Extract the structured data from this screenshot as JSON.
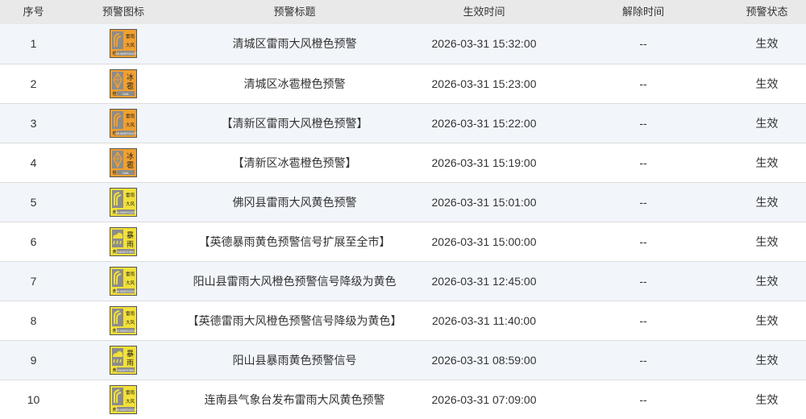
{
  "header": {
    "index": "序号",
    "icon": "预警图标",
    "title": "预警标题",
    "start_time": "生效时间",
    "end_time": "解除时间",
    "status": "预警状态"
  },
  "colors": {
    "orange": "#f0a030",
    "yellow": "#f2e13a",
    "grey": "#8c8c8c"
  },
  "rows": [
    {
      "index": "1",
      "icon": {
        "name": "thunder-wind-orange-icon",
        "type": "thunder-wind",
        "color": "orange",
        "top": "雷雨",
        "bottom": "大风",
        "tag": "橙",
        "foot": "THUNDERGUST"
      },
      "title": "清城区雷雨大风橙色预警",
      "start_time": "2026-03-31 15:32:00",
      "end_time": "--",
      "status": "生效"
    },
    {
      "index": "2",
      "icon": {
        "name": "hail-orange-icon",
        "type": "hail",
        "color": "orange",
        "top": "冰",
        "bottom": "雹",
        "tag": "橙",
        "foot": "HAIL"
      },
      "title": "清城区冰雹橙色预警",
      "start_time": "2026-03-31 15:23:00",
      "end_time": "--",
      "status": "生效"
    },
    {
      "index": "3",
      "icon": {
        "name": "thunder-wind-orange-icon",
        "type": "thunder-wind",
        "color": "orange",
        "top": "雷雨",
        "bottom": "大风",
        "tag": "橙",
        "foot": "THUNDERGUST"
      },
      "title": "【清新区雷雨大风橙色预警】",
      "start_time": "2026-03-31 15:22:00",
      "end_time": "--",
      "status": "生效"
    },
    {
      "index": "4",
      "icon": {
        "name": "hail-orange-icon",
        "type": "hail",
        "color": "orange",
        "top": "冰",
        "bottom": "雹",
        "tag": "橙",
        "foot": "HAIL"
      },
      "title": "【清新区冰雹橙色预警】",
      "start_time": "2026-03-31 15:19:00",
      "end_time": "--",
      "status": "生效"
    },
    {
      "index": "5",
      "icon": {
        "name": "thunder-wind-yellow-icon",
        "type": "thunder-wind",
        "color": "yellow",
        "top": "雷雨",
        "bottom": "大风",
        "tag": "黄",
        "foot": "THUNDERGUST"
      },
      "title": "佛冈县雷雨大风黄色预警",
      "start_time": "2026-03-31 15:01:00",
      "end_time": "--",
      "status": "生效"
    },
    {
      "index": "6",
      "icon": {
        "name": "rainstorm-yellow-icon",
        "type": "rainstorm",
        "color": "yellow",
        "top": "暴",
        "bottom": "雨",
        "tag": "黄",
        "foot": "RAINSTORM"
      },
      "title": "【英德暴雨黄色预警信号扩展至全市】",
      "start_time": "2026-03-31 15:00:00",
      "end_time": "--",
      "status": "生效"
    },
    {
      "index": "7",
      "icon": {
        "name": "thunder-wind-yellow-icon",
        "type": "thunder-wind",
        "color": "yellow",
        "top": "雷雨",
        "bottom": "大风",
        "tag": "黄",
        "foot": "THUNDERGUST"
      },
      "title": "阳山县雷雨大风橙色预警信号降级为黄色",
      "start_time": "2026-03-31 12:45:00",
      "end_time": "--",
      "status": "生效"
    },
    {
      "index": "8",
      "icon": {
        "name": "thunder-wind-yellow-icon",
        "type": "thunder-wind",
        "color": "yellow",
        "top": "雷雨",
        "bottom": "大风",
        "tag": "黄",
        "foot": "THUNDERGUST"
      },
      "title": "【英德雷雨大风橙色预警信号降级为黄色】",
      "start_time": "2026-03-31 11:40:00",
      "end_time": "--",
      "status": "生效"
    },
    {
      "index": "9",
      "icon": {
        "name": "rainstorm-yellow-icon",
        "type": "rainstorm",
        "color": "yellow",
        "top": "暴",
        "bottom": "雨",
        "tag": "黄",
        "foot": "RAINSTORM"
      },
      "title": "阳山县暴雨黄色预警信号",
      "start_time": "2026-03-31 08:59:00",
      "end_time": "--",
      "status": "生效"
    },
    {
      "index": "10",
      "icon": {
        "name": "thunder-wind-yellow-icon",
        "type": "thunder-wind",
        "color": "yellow",
        "top": "雷雨",
        "bottom": "大风",
        "tag": "黄",
        "foot": "THUNDERGUST"
      },
      "title": "连南县气象台发布雷雨大风黄色预警",
      "start_time": "2026-03-31 07:09:00",
      "end_time": "--",
      "status": "生效"
    }
  ]
}
